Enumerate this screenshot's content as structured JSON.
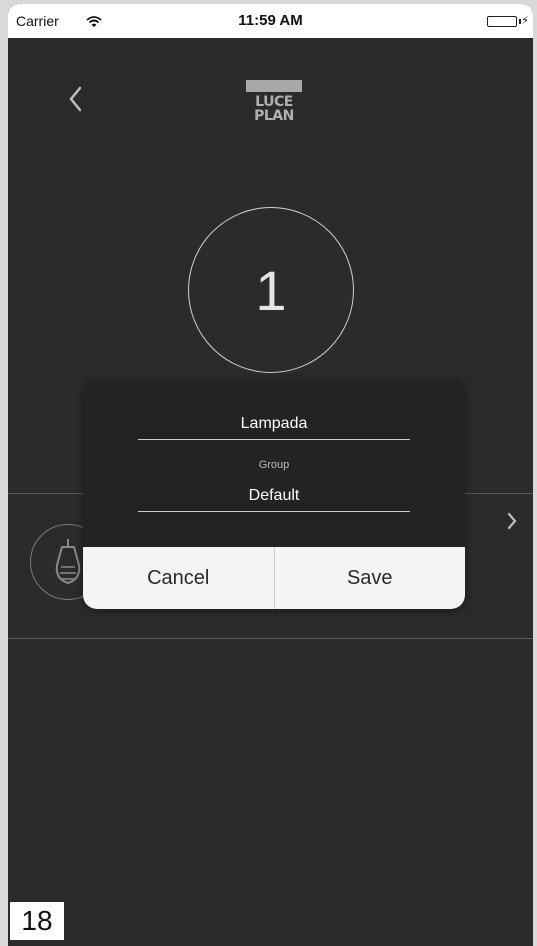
{
  "status_bar": {
    "carrier": "Carrier",
    "time": "11:59 AM",
    "battery_color": "#4cd964",
    "wifi_icon": "wifi-icon",
    "battery_icon": "battery-icon"
  },
  "header": {
    "back_icon": "chevron-left-icon",
    "logo_line1": "LUCE",
    "logo_line2": "PLAN"
  },
  "light": {
    "number": "1"
  },
  "dialog": {
    "name_value": "Lampada",
    "group_label": "Group",
    "group_value": "Default",
    "cancel_label": "Cancel",
    "save_label": "Save"
  },
  "row": {
    "icon": "light-bulb-icon",
    "chevron_icon": "chevron-right-icon"
  },
  "step_badge": "18"
}
